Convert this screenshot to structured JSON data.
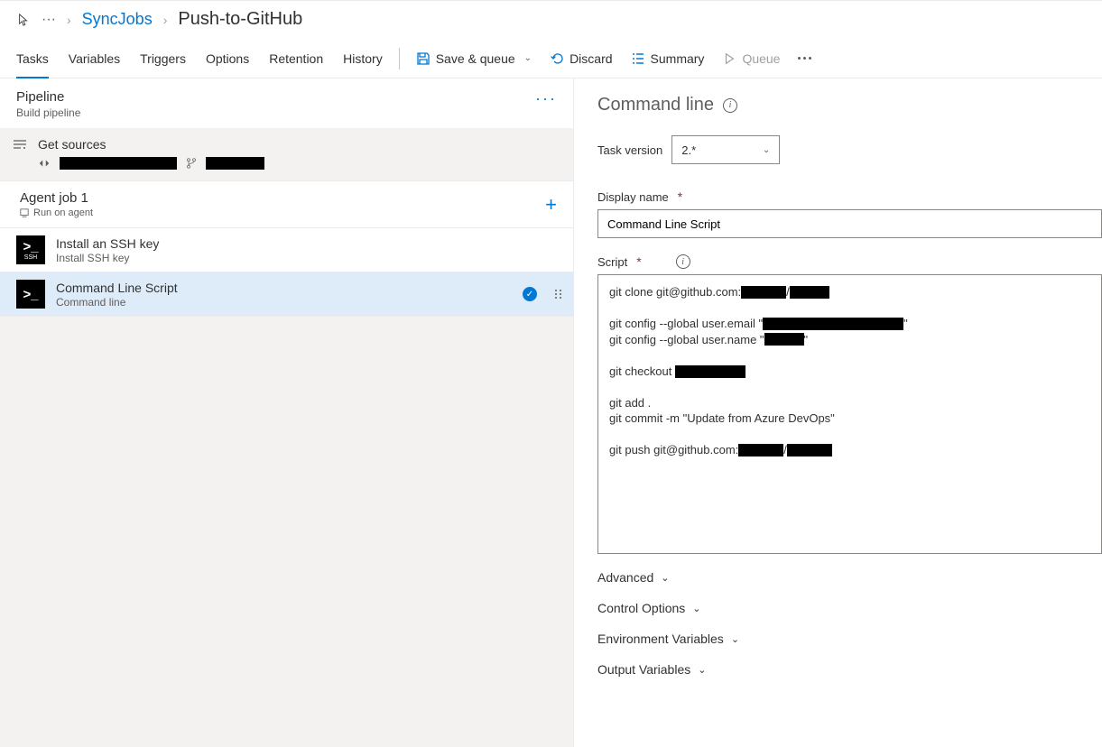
{
  "breadcrumb": {
    "project_link": "SyncJobs",
    "current": "Push-to-GitHub"
  },
  "tabs": [
    "Tasks",
    "Variables",
    "Triggers",
    "Options",
    "Retention",
    "History"
  ],
  "active_tab": "Tasks",
  "commands": {
    "save_queue": "Save & queue",
    "discard": "Discard",
    "summary": "Summary",
    "queue": "Queue"
  },
  "pipeline": {
    "title": "Pipeline",
    "subtitle": "Build pipeline",
    "get_sources": "Get sources"
  },
  "job": {
    "title": "Agent job 1",
    "subtitle": "Run on agent"
  },
  "tasks_list": [
    {
      "title": "Install an SSH key",
      "subtitle": "Install SSH key",
      "icon": "ssh",
      "selected": false
    },
    {
      "title": "Command Line Script",
      "subtitle": "Command line",
      "icon": "cmd",
      "selected": true
    }
  ],
  "detail": {
    "heading": "Command line",
    "task_version_label": "Task version",
    "task_version_value": "2.*",
    "display_name_label": "Display name",
    "display_name_value": "Command Line Script",
    "script_label": "Script",
    "script_lines": {
      "l1a": "git clone git@github.com:",
      "l1b": "/",
      "l2a": "git config --global user.email \"",
      "l2b": "\"",
      "l3a": "git config --global user.name \"",
      "l3b": "\"",
      "l4": "git checkout ",
      "l5": "git add .",
      "l6": "git commit -m \"Update from Azure DevOps\"",
      "l7a": "git push git@github.com:",
      "l7b": "/"
    },
    "sections": [
      "Advanced",
      "Control Options",
      "Environment Variables",
      "Output Variables"
    ]
  }
}
